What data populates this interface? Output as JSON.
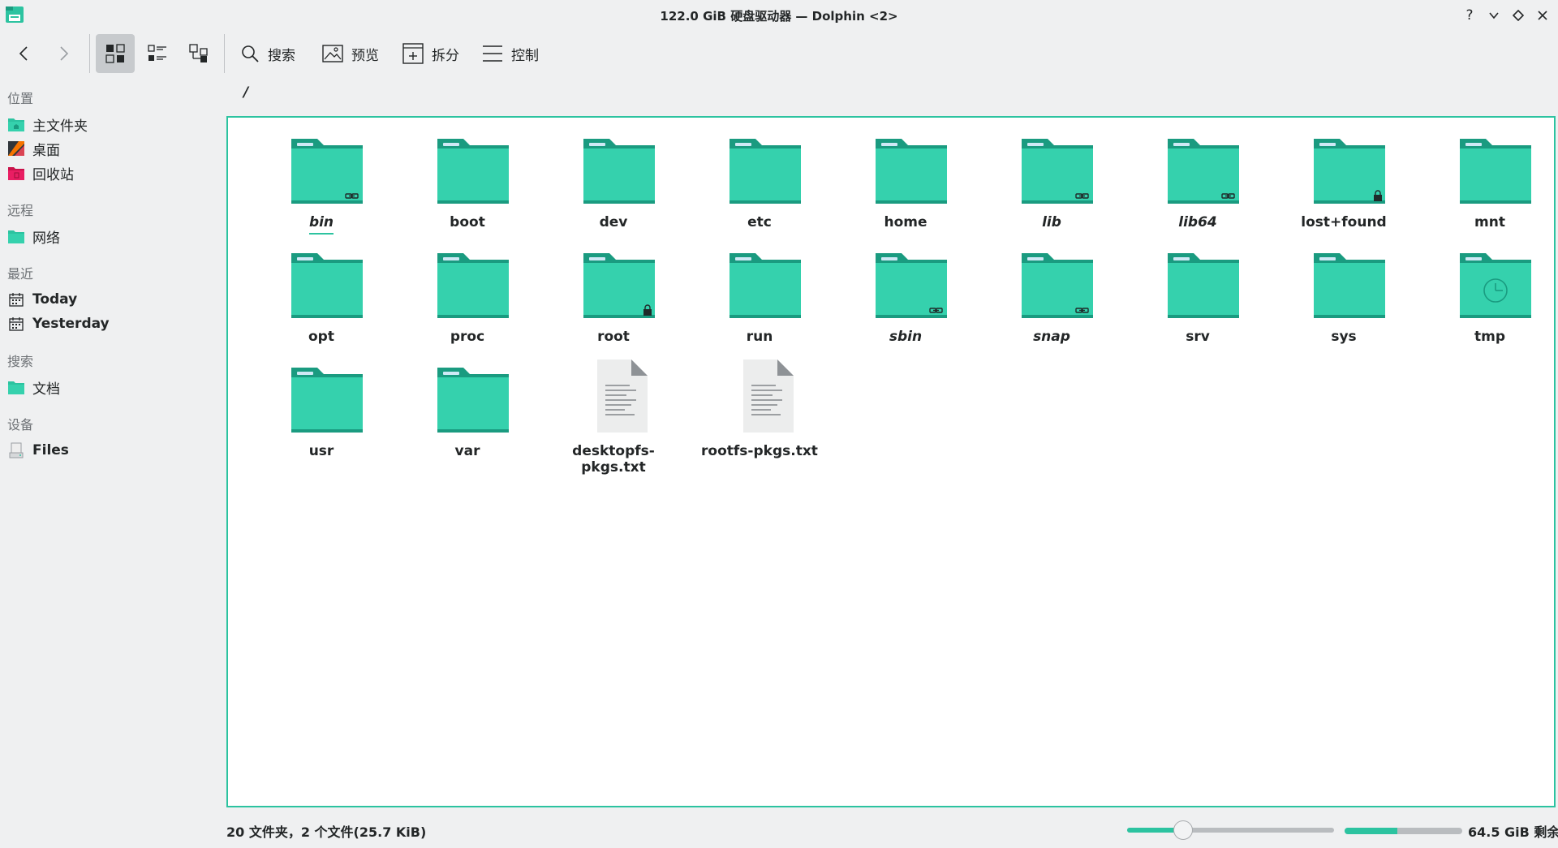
{
  "window": {
    "title": "122.0 GiB 硬盘驱动器 — Dolphin <2>"
  },
  "toolbar": {
    "back": "back-arrow-icon",
    "forward": "forward-arrow-icon",
    "search_label": "搜索",
    "preview_label": "预览",
    "split_label": "拆分",
    "control_label": "控制"
  },
  "sidebar": {
    "sections": {
      "places": "位置",
      "remote": "远程",
      "recent": "最近",
      "search": "搜索",
      "devices": "设备"
    },
    "items": {
      "home": "主文件夹",
      "desktop": "桌面",
      "trash": "回收站",
      "network": "网络",
      "today": "Today",
      "yesterday": "Yesterday",
      "documents": "文档",
      "files": "Files"
    }
  },
  "breadcrumb": "/",
  "files": [
    {
      "name": "bin",
      "type": "folder",
      "emblem": "link",
      "italic": true,
      "focused": true
    },
    {
      "name": "boot",
      "type": "folder"
    },
    {
      "name": "dev",
      "type": "folder"
    },
    {
      "name": "etc",
      "type": "folder"
    },
    {
      "name": "home",
      "type": "folder"
    },
    {
      "name": "lib",
      "type": "folder",
      "emblem": "link",
      "italic": true
    },
    {
      "name": "lib64",
      "type": "folder",
      "emblem": "link",
      "italic": true
    },
    {
      "name": "lost+found",
      "type": "folder",
      "emblem": "lock"
    },
    {
      "name": "mnt",
      "type": "folder"
    },
    {
      "name": "opt",
      "type": "folder"
    },
    {
      "name": "proc",
      "type": "folder"
    },
    {
      "name": "root",
      "type": "folder",
      "emblem": "lock"
    },
    {
      "name": "run",
      "type": "folder"
    },
    {
      "name": "sbin",
      "type": "folder",
      "emblem": "link",
      "italic": true
    },
    {
      "name": "snap",
      "type": "folder",
      "emblem": "link",
      "italic": true
    },
    {
      "name": "srv",
      "type": "folder"
    },
    {
      "name": "sys",
      "type": "folder"
    },
    {
      "name": "tmp",
      "type": "folder",
      "emblem": "clock"
    },
    {
      "name": "usr",
      "type": "folder"
    },
    {
      "name": "var",
      "type": "folder"
    },
    {
      "name": "desktopfs-pkgs.txt",
      "type": "text"
    },
    {
      "name": "rootfs-pkgs.txt",
      "type": "text"
    }
  ],
  "status": {
    "summary": "20 文件夹，2 个文件(25.7 KiB)",
    "zoom_level": 0.27,
    "space_used_fraction": 0.45,
    "free_space": "64.5 GiB 剩余"
  },
  "colors": {
    "accent": "#2cc3a0",
    "folder_light": "#35d1ad",
    "folder_dark": "#1a9b80"
  }
}
